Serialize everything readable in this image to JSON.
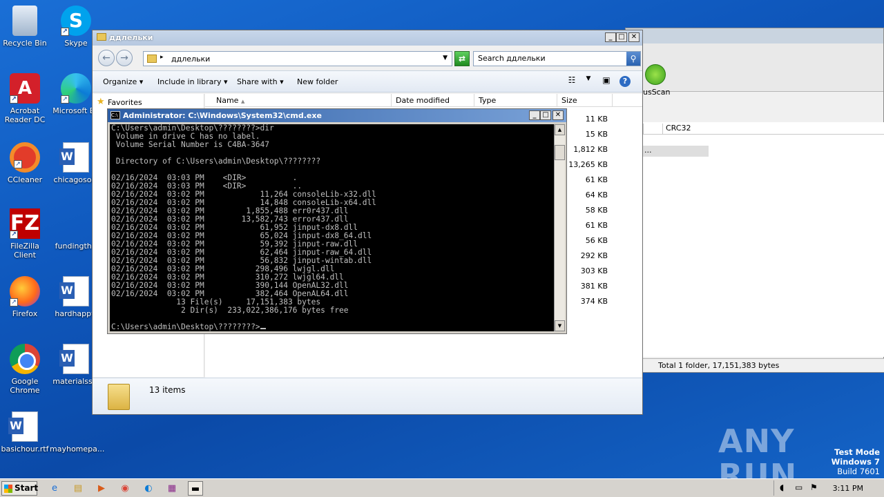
{
  "desktop": {
    "icons": [
      {
        "label": "Recycle Bin"
      },
      {
        "label": "Skype"
      },
      {
        "label": "Acrobat Reader DC"
      },
      {
        "label": "Microsoft Ed"
      },
      {
        "label": "CCleaner"
      },
      {
        "label": "chicagosolu"
      },
      {
        "label": "FileZilla Client"
      },
      {
        "label": "fundingthir"
      },
      {
        "label": "Firefox"
      },
      {
        "label": "hardhappy."
      },
      {
        "label": "Google Chrome"
      },
      {
        "label": "materialssin"
      },
      {
        "label": "basichour.rtf"
      },
      {
        "label": "mayhomepa..."
      }
    ]
  },
  "bg_app": {
    "tool_label": "usScan",
    "col_crc": "CRC32",
    "row_text": "...",
    "status": "Total 1 folder, 17,151,383 bytes"
  },
  "explorer": {
    "title": "ддлельки",
    "address": "ддлельки",
    "search_placeholder": "Search ддлельки",
    "toolbar": {
      "organize": "Organize",
      "include": "Include in library",
      "share": "Share with",
      "newfolder": "New folder"
    },
    "nav_favorites": "Favorites",
    "columns": {
      "name": "Name",
      "date": "Date modified",
      "type": "Type",
      "size": "Size"
    },
    "sizes": [
      "11 KB",
      "15 KB",
      "1,812 KB",
      "13,265 KB",
      "61 KB",
      "64 KB",
      "58 KB",
      "61 KB",
      "56 KB",
      "292 KB",
      "303 KB",
      "381 KB",
      "374 KB"
    ],
    "status_count": "13 items"
  },
  "cmd": {
    "title": "Administrator: C:\\Windows\\System32\\cmd.exe",
    "lines": [
      "C:\\Users\\admin\\Desktop\\????????>dir",
      " Volume in drive C has no label.",
      " Volume Serial Number is C4BA-3647",
      "",
      " Directory of C:\\Users\\admin\\Desktop\\????????",
      "",
      "02/16/2024  03:03 PM    <DIR>          .",
      "02/16/2024  03:03 PM    <DIR>          ..",
      "02/16/2024  03:02 PM            11,264 consoleLib-x32.dll",
      "02/16/2024  03:02 PM            14,848 consoleLib-x64.dll",
      "02/16/2024  03:02 PM         1,855,488 err0r437.dll",
      "02/16/2024  03:02 PM        13,582,743 error437.dll",
      "02/16/2024  03:02 PM            61,952 jinput-dx8.dll",
      "02/16/2024  03:02 PM            65,024 jinput-dx8_64.dll",
      "02/16/2024  03:02 PM            59,392 jinput-raw.dll",
      "02/16/2024  03:02 PM            62,464 jinput-raw_64.dll",
      "02/16/2024  03:02 PM            56,832 jinput-wintab.dll",
      "02/16/2024  03:02 PM           298,496 lwjgl.dll",
      "02/16/2024  03:02 PM           310,272 lwjgl64.dll",
      "02/16/2024  03:02 PM           390,144 OpenAL32.dll",
      "02/16/2024  03:02 PM           382,464 OpenAL64.dll",
      "              13 File(s)     17,151,383 bytes",
      "               2 Dir(s)  233,022,386,176 bytes free",
      ""
    ],
    "prompt": "C:\\Users\\admin\\Desktop\\????????>"
  },
  "watermark": "ANY RUN",
  "testmode": {
    "line1": "Test Mode",
    "line2": "Windows 7",
    "line3": "Build 7601"
  },
  "taskbar": {
    "start": "Start",
    "clock": "3:11 PM"
  }
}
